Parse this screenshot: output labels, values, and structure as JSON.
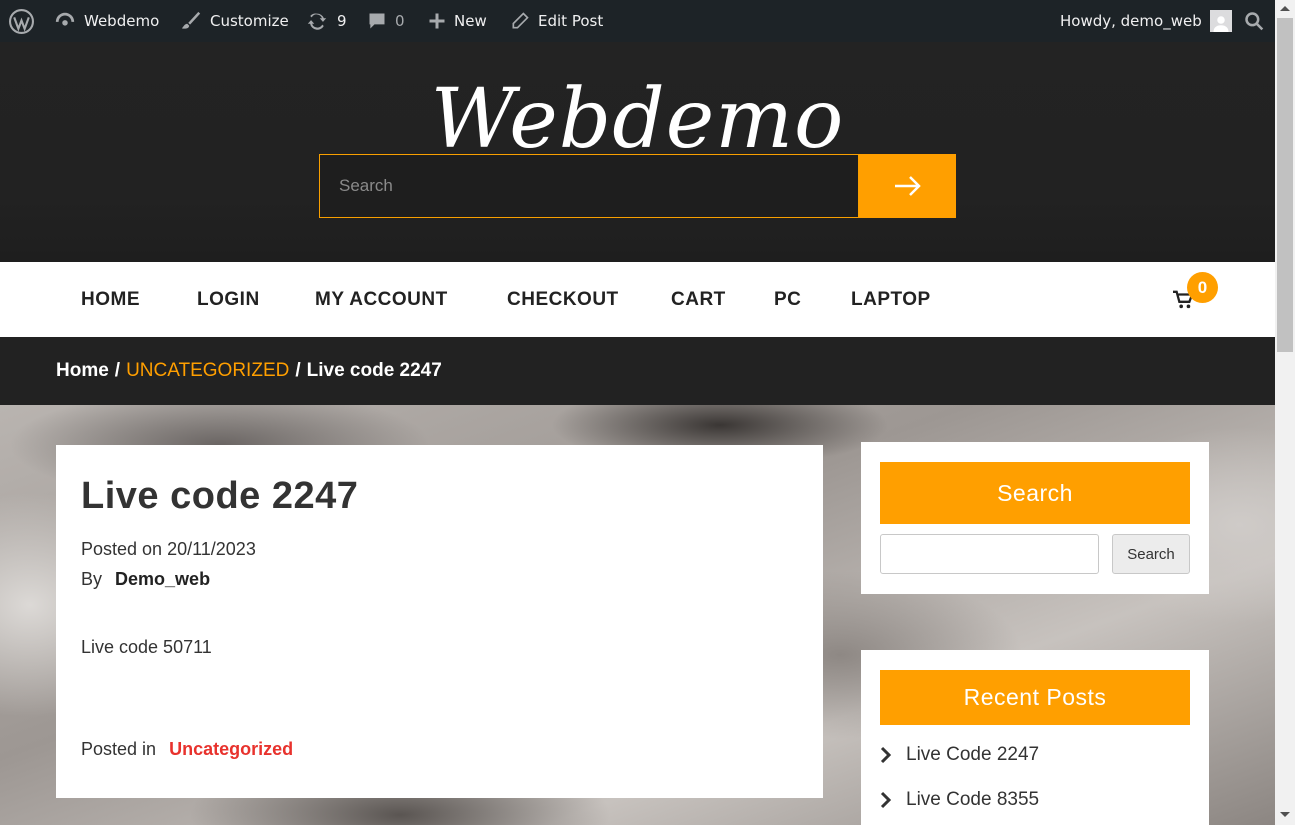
{
  "admin_bar": {
    "site_name": "Webdemo",
    "customize": "Customize",
    "updates_count": "9",
    "comments_count": "0",
    "new_label": "New",
    "edit_post": "Edit Post",
    "howdy": "Howdy, demo_web"
  },
  "header": {
    "site_title": "Webdemo",
    "search_placeholder": "Search"
  },
  "nav": {
    "items": [
      "HOME",
      "LOGIN",
      "MY ACCOUNT",
      "CHECKOUT",
      "CART",
      "PC",
      "LAPTOP"
    ],
    "cart_count": "0"
  },
  "breadcrumb": {
    "home": "Home",
    "sep": "/",
    "category": "UNCATEGORIZED",
    "current": "Live code 2247"
  },
  "post": {
    "title": "Live code 2247",
    "date_prefix": "Posted on",
    "date": "20/11/2023",
    "author_prefix": "By",
    "author": "Demo_web",
    "body": "Live code 50711",
    "posted_in": "Posted in",
    "category": "Uncategorized"
  },
  "sidebar": {
    "search_title": "Search",
    "search_button": "Search",
    "recent_title": "Recent Posts",
    "recent": [
      "Live Code 2247",
      "Live Code 8355"
    ]
  },
  "colors": {
    "accent": "#ff9f00",
    "category_link": "#e8322d",
    "dark_bg": "#222222"
  }
}
